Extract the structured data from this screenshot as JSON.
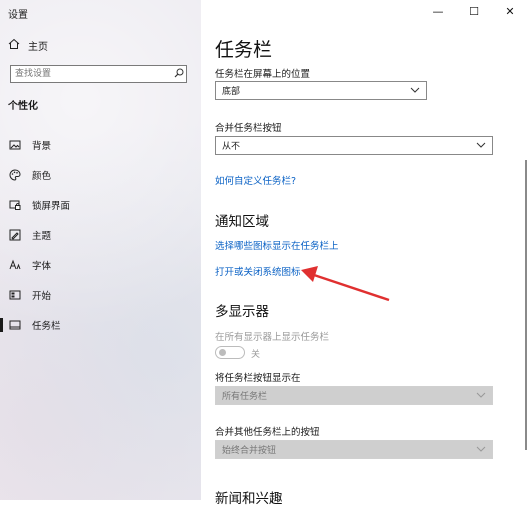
{
  "window": {
    "title": "设置"
  },
  "sidebar": {
    "home_label": "主页",
    "search_placeholder": "查找设置",
    "section_title": "个性化",
    "items": [
      {
        "label": "背景",
        "icon": "picture-icon"
      },
      {
        "label": "颜色",
        "icon": "palette-icon"
      },
      {
        "label": "锁屏界面",
        "icon": "lock-screen-icon"
      },
      {
        "label": "主题",
        "icon": "brush-icon"
      },
      {
        "label": "字体",
        "icon": "font-icon"
      },
      {
        "label": "开始",
        "icon": "start-menu-icon"
      },
      {
        "label": "任务栏",
        "icon": "taskbar-icon",
        "active": true
      }
    ]
  },
  "main": {
    "title": "任务栏",
    "position_label": "任务栏在屏幕上的位置",
    "position_value": "底部",
    "combine_label": "合并任务栏按钮",
    "combine_value": "从不",
    "customize_link": "如何自定义任务栏?",
    "notify_heading": "通知区域",
    "notify_link_1": "选择哪些图标显示在任务栏上",
    "notify_link_2": "打开或关闭系统图标",
    "multi_heading": "多显示器",
    "show_all_label": "在所有显示器上显示任务栏",
    "toggle_state": "关",
    "show_buttons_label": "将任务栏按钮显示在",
    "show_buttons_value": "所有任务栏",
    "combine_other_label": "合并其他任务栏上的按钮",
    "combine_other_value": "始终合并按钮",
    "next_heading": "新闻和兴趣"
  },
  "colors": {
    "link": "#0b62c5",
    "arrow": "#e03030",
    "sidebar_bg": "#eceaf0"
  }
}
